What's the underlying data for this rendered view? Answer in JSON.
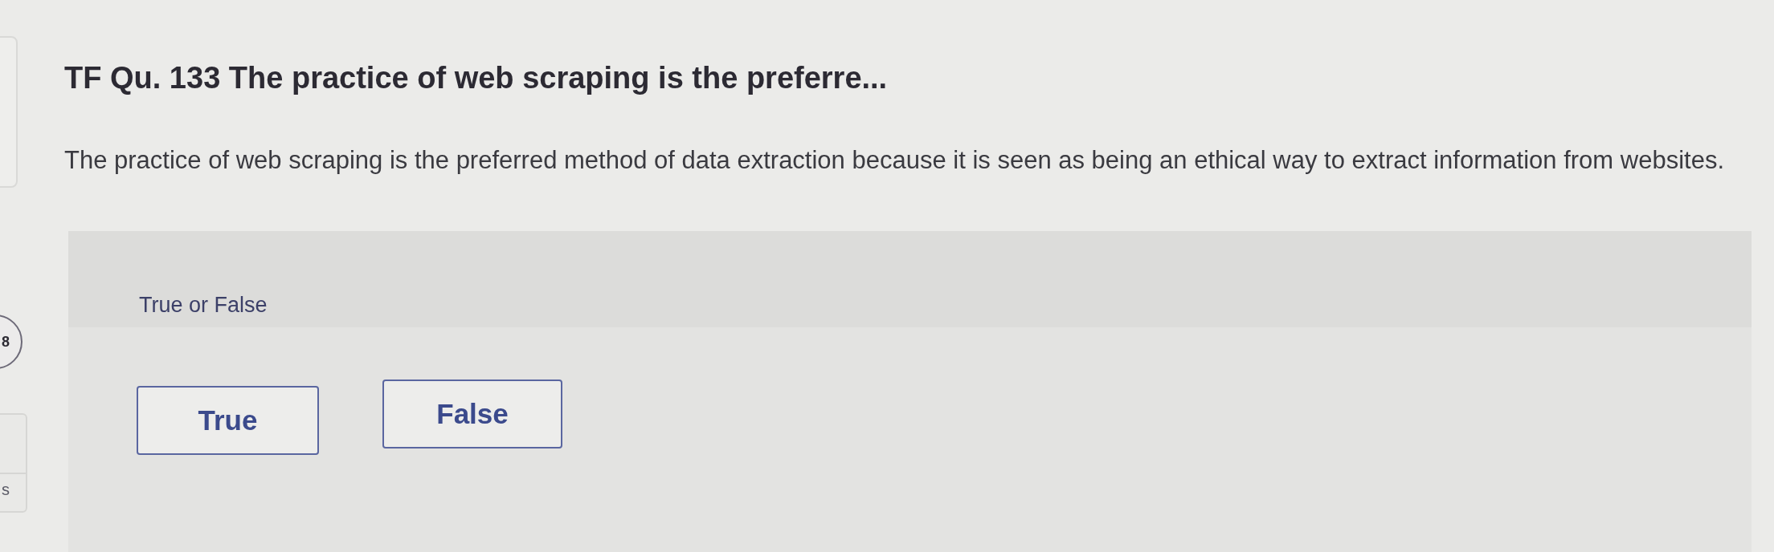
{
  "left_rail": {
    "question_number": "8",
    "cut_label": "s"
  },
  "question": {
    "title": "TF Qu. 133 The practice of web scraping is the preferre...",
    "prompt": "The practice of web scraping is the preferred method of data extraction because it is seen as being an ethical way to extract information from websites."
  },
  "answer_panel": {
    "instruction": "True or False",
    "options": [
      {
        "label": "True",
        "selected": false
      },
      {
        "label": "False",
        "selected": false
      }
    ]
  }
}
